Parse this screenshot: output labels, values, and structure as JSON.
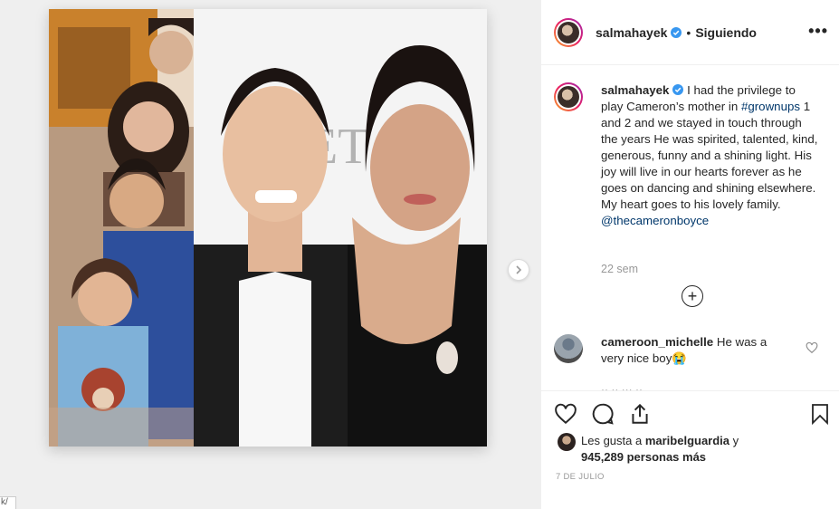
{
  "post": {
    "username": "salmahayek",
    "separator": "•",
    "follow_status": "Siguiendo",
    "more": "•••"
  },
  "caption": {
    "username": "salmahayek",
    "text_1": " I had the privilege to play Cameron’s mother in ",
    "hashtag": "#grownups",
    "text_2": " 1 and 2 and we stayed in touch through the years He was spirited, talented, kind, generous, funny and a shining light. His joy will live in our hearts forever as he goes on dancing and shining elsewhere. My heart goes to his lovely family. ",
    "mention": "@thecameronboyce",
    "time": "22 sem"
  },
  "load_more": "+",
  "comment": {
    "username": "cameroon_michelle",
    "text": " He was a very nice boy😭"
  },
  "likes": {
    "prefix": "Les gusta a ",
    "user": "maribelguardia",
    "mid": " y",
    "count": "945,289 personas más"
  },
  "date": "7 DE JULIO",
  "url_fragment": "k/",
  "colors": {
    "link": "#00376b",
    "verified": "#3897f0",
    "muted": "#999999"
  },
  "icons": [
    "heart-icon",
    "comment-icon",
    "share-icon",
    "bookmark-icon",
    "chevron-right-icon",
    "verified-icon",
    "more-icon",
    "plus-circle-icon"
  ]
}
